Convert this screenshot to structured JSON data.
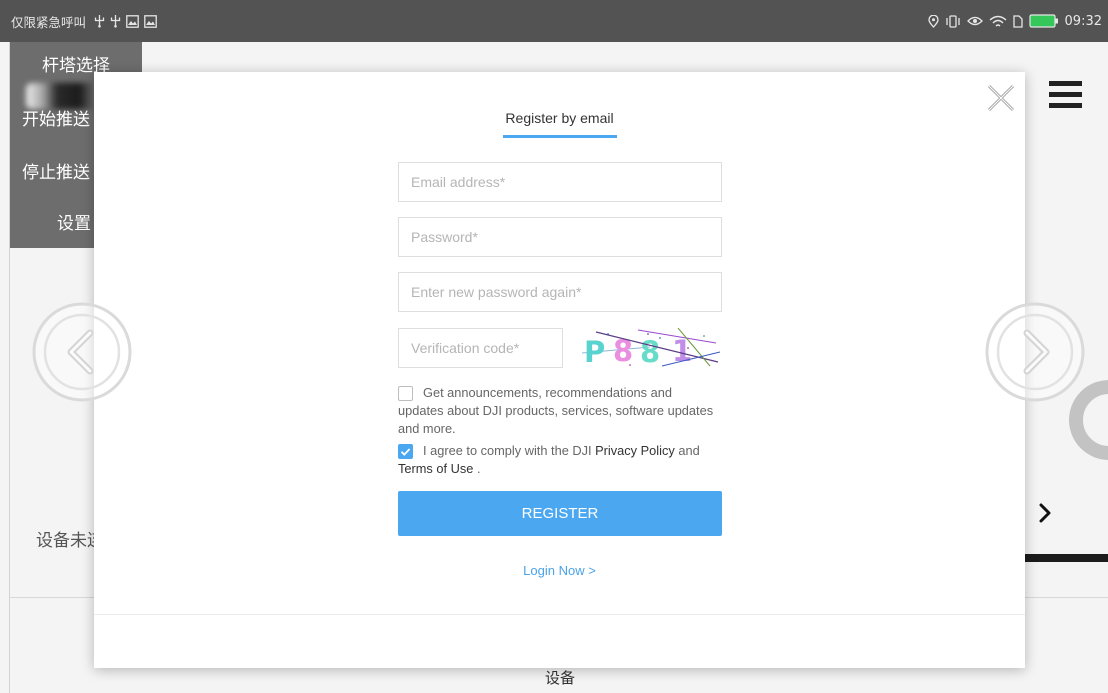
{
  "status_bar": {
    "carrier_text": "仅限紧急呼叫",
    "left_icons": [
      "usb-icon",
      "usb-icon",
      "image-icon",
      "image-icon"
    ],
    "right_icons": [
      "location-icon",
      "vibrate-icon",
      "eye-icon",
      "wifi-icon",
      "sim-icon",
      "battery-icon"
    ],
    "time": "09:32"
  },
  "side_menu": {
    "items": [
      {
        "label": "杆塔选择"
      },
      {
        "label": "开始推送"
      },
      {
        "label": "停止推送"
      },
      {
        "label": "设置"
      }
    ]
  },
  "page": {
    "device_status": "设备未连",
    "bottom_tab": "设备",
    "icons": [
      "chevron-left-icon",
      "chevron-right-icon",
      "hamburger-menu-icon",
      "loading-ring-icon"
    ]
  },
  "modal": {
    "tab_label": "Register by email",
    "close_icon": "close-icon",
    "email": {
      "placeholder": "Email address*",
      "value": ""
    },
    "password": {
      "placeholder": "Password*",
      "value": ""
    },
    "password_confirm": {
      "placeholder": "Enter new password again*",
      "value": ""
    },
    "verification": {
      "placeholder": "Verification code*",
      "value": ""
    },
    "captcha": {
      "chars": [
        "P",
        "8",
        "8",
        "1"
      ]
    },
    "newsletter": {
      "checked": false,
      "lines": [
        "Get announcements, recommendations and",
        "updates about DJI products, services, software updates",
        "and more."
      ]
    },
    "agreement": {
      "checked": true,
      "prefix": "I agree to comply with the DJI ",
      "privacy_link": "Privacy Policy",
      "middle": " and",
      "terms_link": "Terms of Use",
      "suffix": " ."
    },
    "register_button": "REGISTER",
    "login_link": "Login Now >"
  },
  "colors": {
    "accent": "#4aa7f0",
    "link": "#4aa3e8",
    "status_bar": "#535353",
    "side_menu": "#6d6d6d",
    "battery": "#35c75a"
  }
}
